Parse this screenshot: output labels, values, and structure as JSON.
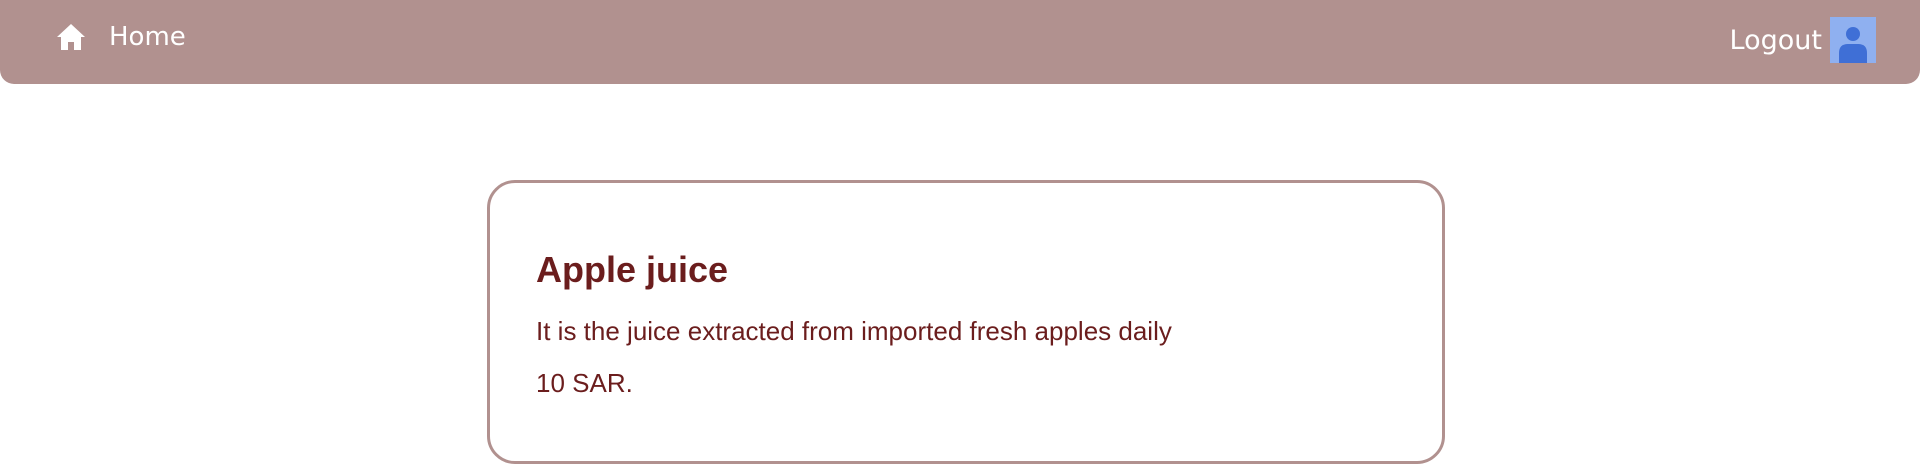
{
  "navbar": {
    "home_icon": "home-icon",
    "home_label": "Home",
    "logout_label": "Logout",
    "avatar_icon": "user-avatar-icon",
    "background_color": "#b1918f"
  },
  "product": {
    "title": "Apple juice",
    "description": "It is the juice extracted from imported fresh apples daily",
    "price": "10 SAR.",
    "text_color": "#6b1d1d",
    "border_color": "#b1918f"
  }
}
